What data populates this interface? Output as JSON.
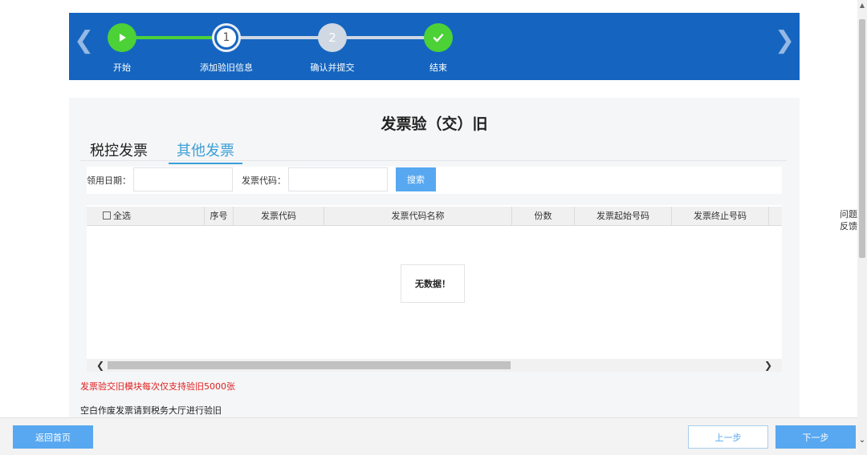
{
  "stepper": {
    "steps": [
      {
        "label": "开始"
      },
      {
        "label": "添加验旧信息",
        "number": "1"
      },
      {
        "label": "确认并提交",
        "number": "2"
      },
      {
        "label": "结束"
      }
    ],
    "colors": {
      "banner": "#1565c0",
      "done": "#4cd137",
      "todo": "#cfd8e3"
    }
  },
  "main": {
    "title": "发票验（交）旧",
    "tabs": [
      {
        "label": "税控发票",
        "active": false
      },
      {
        "label": "其他发票",
        "active": true
      }
    ],
    "search": {
      "date_label": "领用日期：",
      "code_label": "发票代码：",
      "date_value": "",
      "code_value": "",
      "button": "搜索"
    },
    "table": {
      "select_all": "全选",
      "columns": [
        "序号",
        "发票代码",
        "发票代码名称",
        "份数",
        "发票起始号码",
        "发票终止号码"
      ],
      "rows": [],
      "empty_text": "无数据！"
    },
    "notice_red": "发票验交旧模块每次仅支持验旧5000张",
    "notice": "空白作废发票请到税务大厅进行验旧"
  },
  "footer": {
    "home": "返回首页",
    "prev": "上一步",
    "next": "下一步"
  },
  "feedback": {
    "line1": "问题",
    "line2": "反馈"
  },
  "accent": "#57a8f0"
}
